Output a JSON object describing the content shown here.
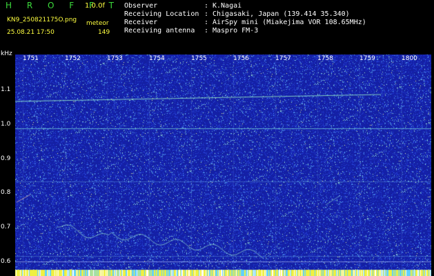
{
  "header": {
    "brand": "H R O F F T",
    "version": "1.0.0f",
    "filename": "KN9_250821175O.png",
    "mode": "meteor",
    "datetime": "25.08.21 17:50",
    "count": "149"
  },
  "station": {
    "rows": [
      {
        "label": "Observer",
        "value": "K.Nagai"
      },
      {
        "label": "Receiving Location",
        "value": "Chigasaki, Japan (139.414 35.340)"
      },
      {
        "label": "Receiver",
        "value": "AirSpy mini (Miakejima VOR 108.65MHz)"
      },
      {
        "label": "Receiving antenna",
        "value": "Maspro FM-3"
      }
    ]
  },
  "spectrogram": {
    "y_unit": "kHz",
    "y_ticks": [
      "1.1",
      "1.0",
      "0.9",
      "0.8",
      "0.7",
      "0.6"
    ],
    "x_ticks": [
      "1751",
      "1752",
      "1753",
      "1754",
      "1755",
      "1756",
      "1757",
      "1758",
      "1759",
      "1800"
    ],
    "background_color": "#1a2ba8",
    "signal_color": "#9cf0c8"
  }
}
